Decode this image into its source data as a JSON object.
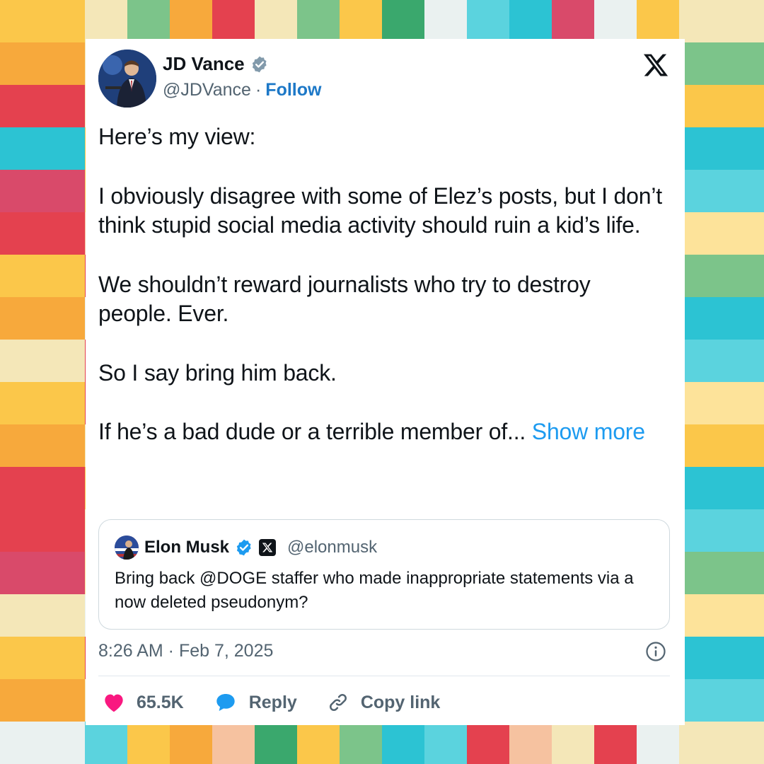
{
  "palette": {
    "brand_blue": "#1d9bf0",
    "follow_blue": "#1d78c7",
    "like_pink": "#f91880",
    "reply_blue": "#1d9bf0",
    "text": "#0f1419",
    "muted": "#536471",
    "mosaic": [
      "#fbc74a",
      "#f7a93c",
      "#e4414f",
      "#2cc3d3",
      "#5bd3de",
      "#f4e7b8",
      "#7cc48a",
      "#eaf1f0",
      "#f6c2a0",
      "#d94a6a",
      "#3aa86d",
      "#fde39a"
    ]
  },
  "tweet": {
    "author_name": "JD Vance",
    "author_handle": "@JDVance",
    "separator": "·",
    "follow_label": "Follow",
    "platform_icon": "x-logo-icon",
    "paragraphs": [
      "Here’s my view:",
      "I obviously disagree with some of Elez’s posts, but I don’t think stupid social media activity should ruin a kid’s life.",
      "We shouldn’t reward journalists who try to destroy people. Ever.",
      "So I say bring him back."
    ],
    "truncated_paragraph": "If he’s a bad dude or a terrible member of...",
    "show_more_label": "Show more",
    "quoted": {
      "author_name": "Elon Musk",
      "author_handle": "@elonmusk",
      "text": "Bring back @DOGE staffer who made inappropriate statements via a now deleted pseudonym?"
    },
    "timestamp": "8:26 AM · Feb 7, 2025",
    "actions": {
      "likes": "65.5K",
      "reply_label": "Reply",
      "copy_link_label": "Copy link"
    }
  }
}
